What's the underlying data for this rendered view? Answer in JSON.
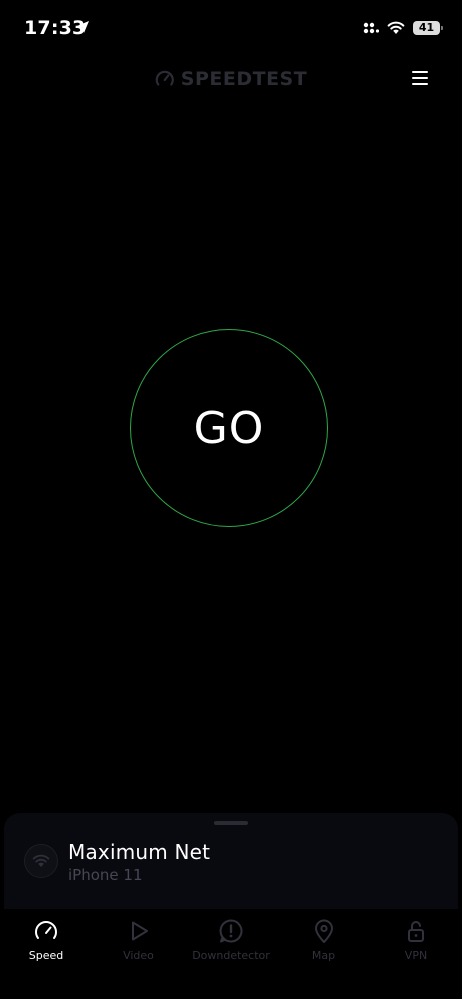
{
  "status_bar": {
    "time": "17:33",
    "battery": "41"
  },
  "header": {
    "logo_text": "SPEEDTEST"
  },
  "main": {
    "go_label": "GO"
  },
  "connection": {
    "network_name": "Maximum Net",
    "device_name": "iPhone 11"
  },
  "tabs": [
    {
      "label": "Speed",
      "icon": "speedometer-icon",
      "active": true
    },
    {
      "label": "Video",
      "icon": "play-icon",
      "active": false
    },
    {
      "label": "Downdetector",
      "icon": "alert-icon",
      "active": false
    },
    {
      "label": "Map",
      "icon": "map-pin-icon",
      "active": false
    },
    {
      "label": "VPN",
      "icon": "lock-icon",
      "active": false
    }
  ],
  "colors": {
    "background": "#000000",
    "go_ring": "#2ea84a",
    "logo_dim": "#2b2c34",
    "tab_inactive": "#31323c",
    "tab_active": "#ffffff",
    "sheet_bg": "#090910"
  }
}
